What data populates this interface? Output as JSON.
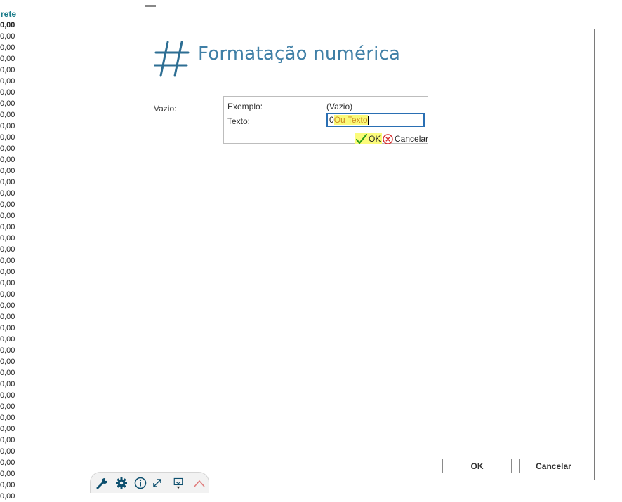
{
  "background": {
    "column_header": "rete",
    "values": [
      "0,00",
      "0,00",
      "0,00",
      "0,00",
      "0,00",
      "0,00",
      "0,00",
      "0,00",
      "0,00",
      "0,00",
      "0,00",
      "0,00",
      "0,00",
      "0,00",
      "0,00",
      "0,00",
      "0,00",
      "0,00",
      "0,00",
      "0,00",
      "0,00",
      "0,00",
      "0,00",
      "0,00",
      "0,00",
      "0,00",
      "0,00",
      "0,00",
      "0,00",
      "0,00",
      "0,00",
      "0,00",
      "0,00",
      "0,00",
      "0,00",
      "0,00",
      "0,00",
      "0,00",
      "0,00",
      "0,00",
      "0,00",
      "0,00",
      "0,00"
    ]
  },
  "dialog": {
    "title": "Formatação numérica",
    "field_label": "Vazio:",
    "editor": {
      "example_label": "Exemplo:",
      "example_value": "(Vazio)",
      "text_label": "Texto:",
      "text_value_prefix": "0",
      "text_value_highlight": "Ou Texto",
      "ok_label": "OK",
      "cancel_label": "Cancelar"
    },
    "ok_button": "OK",
    "cancel_button": "Cancelar"
  },
  "toolbar": {
    "icons": [
      "wrench-icon",
      "gear-icon",
      "info-icon",
      "expand-icon",
      "export-icon",
      "close-icon"
    ]
  },
  "colors": {
    "title": "#3f7fa6",
    "highlight": "#fbfb7a",
    "input_border": "#2a6fb3",
    "ok_check": "#2e9e1a",
    "cancel_x": "#d62b2b"
  }
}
